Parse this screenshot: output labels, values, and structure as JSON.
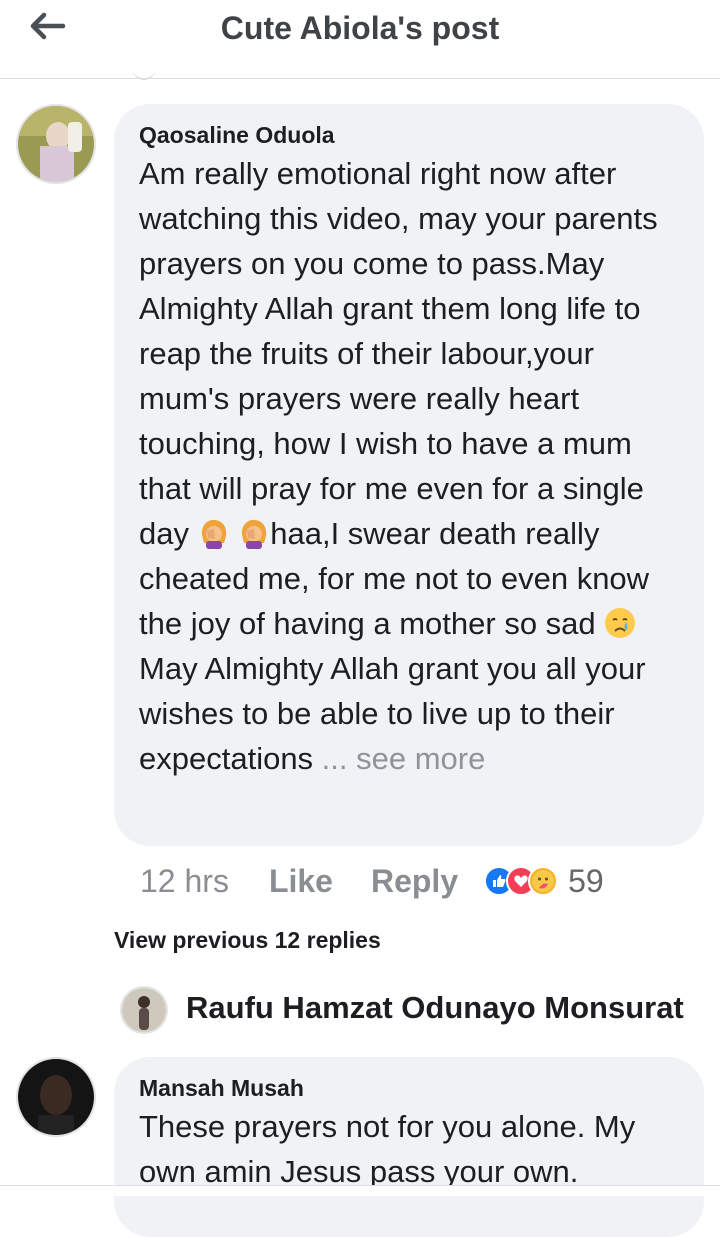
{
  "header": {
    "title": "Cute Abiola's post",
    "back_icon": "arrow-left-icon"
  },
  "comments": [
    {
      "author": "Qaosaline Oduola",
      "text_part1": "Am really emotional right now after watching this video, may your parents prayers on you come to pass.May Almighty Allah grant them long life to reap the fruits of their labour,your mum's prayers were really heart touching, how I wish to have a mum that will pray for me even for a single day ",
      "text_part2": "haa,I swear death really cheated me, for me not to even know the joy of having a mother so sad ",
      "text_part3": " May Almighty Allah grant you all your wishes to be able to live up to their expectations ",
      "see_more": "... see more",
      "time": "12 hrs",
      "like_label": "Like",
      "reply_label": "Reply",
      "reaction_icons": [
        "like-icon",
        "love-icon",
        "care-icon"
      ],
      "reaction_count": "59"
    },
    {
      "author": "Mansah Musah",
      "text": "These prayers not for you alone. My own amin Jesus pass your own."
    }
  ],
  "view_previous": "View previous 12 replies",
  "reply_preview": {
    "name": "Raufu Hamzat Odunayo Monsurat"
  },
  "colors": {
    "bubble": "#f0f2f5",
    "like_blue": "#1877f2",
    "love_red": "#f33e58",
    "care_yellow": "#f7b125"
  }
}
